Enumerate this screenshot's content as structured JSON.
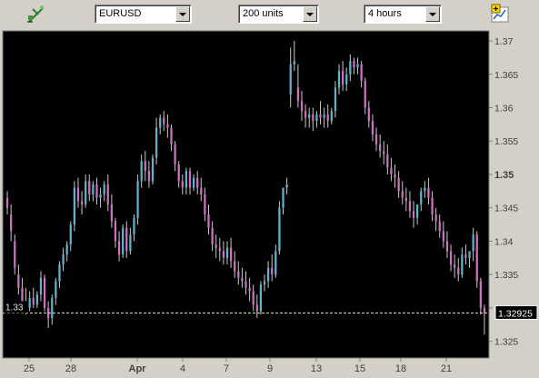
{
  "toolbar": {
    "left_icon": "chart-tool-icon",
    "right_icon": "add-chart-icon",
    "symbol": "EURUSD",
    "units": "200 units",
    "timeframe": "4 hours"
  },
  "colors": {
    "background": "#000000",
    "bullish": "#5fb4c8",
    "bearish": "#d070c0",
    "last_price_line": "#f0e6b0",
    "axis_panel": "#d4d0c8"
  },
  "chart_data": {
    "type": "candlestick",
    "title": "",
    "xlabel": "",
    "ylabel": "",
    "ylim": [
      1.3225,
      1.3715
    ],
    "y_ticks": [
      "1.37",
      "1.365",
      "1.36",
      "1.355",
      "1.35",
      "1.345",
      "1.34",
      "1.335",
      "1.33",
      "1.325"
    ],
    "x_ticks": [
      "25",
      "28",
      "Apr",
      "4",
      "7",
      "9",
      "13",
      "15",
      "18",
      "21"
    ],
    "left_price_label": "1.33",
    "last_price": "1.32925",
    "grid": false,
    "candles": [
      [
        1.3465,
        1.3475,
        1.345,
        1.344
      ],
      [
        1.344,
        1.3455,
        1.3415,
        1.34
      ],
      [
        1.34,
        1.341,
        1.336,
        1.335
      ],
      [
        1.335,
        1.3365,
        1.333,
        1.332
      ],
      [
        1.333,
        1.3345,
        1.331,
        1.3305
      ],
      [
        1.331,
        1.333,
        1.33,
        1.329
      ],
      [
        1.33,
        1.3325,
        1.3315,
        1.3295
      ],
      [
        1.3315,
        1.333,
        1.3305,
        1.33
      ],
      [
        1.3305,
        1.3325,
        1.332,
        1.33
      ],
      [
        1.332,
        1.3355,
        1.3345,
        1.331
      ],
      [
        1.3345,
        1.335,
        1.33,
        1.3295
      ],
      [
        1.33,
        1.331,
        1.3285,
        1.327
      ],
      [
        1.3285,
        1.332,
        1.3315,
        1.3275
      ],
      [
        1.3315,
        1.3345,
        1.334,
        1.3305
      ],
      [
        1.334,
        1.337,
        1.3365,
        1.333
      ],
      [
        1.3365,
        1.339,
        1.338,
        1.3355
      ],
      [
        1.338,
        1.34,
        1.3395,
        1.337
      ],
      [
        1.3395,
        1.343,
        1.3425,
        1.3385
      ],
      [
        1.3425,
        1.349,
        1.348,
        1.3415
      ],
      [
        1.348,
        1.3495,
        1.346,
        1.345
      ],
      [
        1.346,
        1.3475,
        1.3455,
        1.344
      ],
      [
        1.3455,
        1.35,
        1.349,
        1.345
      ],
      [
        1.349,
        1.35,
        1.347,
        1.346
      ],
      [
        1.347,
        1.349,
        1.3485,
        1.346
      ],
      [
        1.3485,
        1.3495,
        1.3465,
        1.3455
      ],
      [
        1.3465,
        1.348,
        1.347,
        1.345
      ],
      [
        1.347,
        1.349,
        1.3485,
        1.346
      ],
      [
        1.3485,
        1.35,
        1.3455,
        1.3445
      ],
      [
        1.3455,
        1.347,
        1.343,
        1.342
      ],
      [
        1.343,
        1.3435,
        1.34,
        1.339
      ],
      [
        1.34,
        1.3415,
        1.338,
        1.337
      ],
      [
        1.338,
        1.3425,
        1.342,
        1.3375
      ],
      [
        1.342,
        1.343,
        1.3385,
        1.3375
      ],
      [
        1.3385,
        1.342,
        1.341,
        1.338
      ],
      [
        1.341,
        1.344,
        1.3435,
        1.34
      ],
      [
        1.3435,
        1.35,
        1.349,
        1.3425
      ],
      [
        1.349,
        1.353,
        1.352,
        1.348
      ],
      [
        1.352,
        1.3535,
        1.3505,
        1.349
      ],
      [
        1.3505,
        1.352,
        1.349,
        1.348
      ],
      [
        1.349,
        1.353,
        1.3525,
        1.3485
      ],
      [
        1.3525,
        1.3585,
        1.357,
        1.3515
      ],
      [
        1.357,
        1.359,
        1.3585,
        1.356
      ],
      [
        1.3585,
        1.3595,
        1.3575,
        1.3565
      ],
      [
        1.3575,
        1.359,
        1.357,
        1.3555
      ],
      [
        1.357,
        1.3575,
        1.3545,
        1.3535
      ],
      [
        1.3545,
        1.355,
        1.3515,
        1.3505
      ],
      [
        1.3515,
        1.352,
        1.349,
        1.348
      ],
      [
        1.349,
        1.35,
        1.348,
        1.347
      ],
      [
        1.348,
        1.351,
        1.3505,
        1.347
      ],
      [
        1.3505,
        1.351,
        1.348,
        1.347
      ],
      [
        1.348,
        1.35,
        1.3495,
        1.3475
      ],
      [
        1.3495,
        1.3505,
        1.348,
        1.347
      ],
      [
        1.348,
        1.3495,
        1.347,
        1.346
      ],
      [
        1.347,
        1.348,
        1.344,
        1.343
      ],
      [
        1.344,
        1.3455,
        1.342,
        1.341
      ],
      [
        1.342,
        1.343,
        1.3395,
        1.3385
      ],
      [
        1.3395,
        1.341,
        1.339,
        1.3375
      ],
      [
        1.339,
        1.3405,
        1.3385,
        1.337
      ],
      [
        1.3385,
        1.34,
        1.3375,
        1.3365
      ],
      [
        1.3375,
        1.34,
        1.339,
        1.3365
      ],
      [
        1.339,
        1.3405,
        1.337,
        1.336
      ],
      [
        1.337,
        1.3385,
        1.3355,
        1.3345
      ],
      [
        1.3355,
        1.337,
        1.3345,
        1.3335
      ],
      [
        1.3345,
        1.336,
        1.334,
        1.333
      ],
      [
        1.334,
        1.3355,
        1.333,
        1.332
      ],
      [
        1.333,
        1.3345,
        1.3325,
        1.331
      ],
      [
        1.3325,
        1.3335,
        1.3305,
        1.3295
      ],
      [
        1.3305,
        1.332,
        1.3295,
        1.3285
      ],
      [
        1.3295,
        1.334,
        1.3335,
        1.329
      ],
      [
        1.3335,
        1.335,
        1.334,
        1.3325
      ],
      [
        1.334,
        1.337,
        1.336,
        1.333
      ],
      [
        1.336,
        1.338,
        1.335,
        1.334
      ],
      [
        1.335,
        1.3395,
        1.3385,
        1.3345
      ],
      [
        1.3385,
        1.346,
        1.345,
        1.338
      ],
      [
        1.345,
        1.3475,
        1.348,
        1.344
      ],
      [
        1.348,
        1.3495,
        1.3485,
        1.347
      ],
      [
        1.362,
        1.369,
        1.3665,
        1.36
      ],
      [
        1.3665,
        1.37,
        1.367,
        1.3655
      ],
      [
        1.363,
        1.3665,
        1.361,
        1.36
      ],
      [
        1.361,
        1.3625,
        1.3595,
        1.358
      ],
      [
        1.3595,
        1.3605,
        1.3585,
        1.357
      ],
      [
        1.3585,
        1.36,
        1.359,
        1.357
      ],
      [
        1.359,
        1.36,
        1.358,
        1.3565
      ],
      [
        1.358,
        1.3595,
        1.359,
        1.357
      ],
      [
        1.359,
        1.361,
        1.3585,
        1.3575
      ],
      [
        1.3585,
        1.36,
        1.359,
        1.357
      ],
      [
        1.359,
        1.3605,
        1.358,
        1.357
      ],
      [
        1.358,
        1.36,
        1.3595,
        1.3575
      ],
      [
        1.3595,
        1.364,
        1.363,
        1.3585
      ],
      [
        1.363,
        1.3665,
        1.3655,
        1.362
      ],
      [
        1.3655,
        1.367,
        1.3635,
        1.3625
      ],
      [
        1.3635,
        1.366,
        1.365,
        1.3625
      ],
      [
        1.365,
        1.368,
        1.367,
        1.364
      ],
      [
        1.367,
        1.3675,
        1.366,
        1.365
      ],
      [
        1.366,
        1.3675,
        1.3665,
        1.365
      ],
      [
        1.3665,
        1.367,
        1.364,
        1.363
      ],
      [
        1.364,
        1.3645,
        1.36,
        1.359
      ],
      [
        1.36,
        1.361,
        1.358,
        1.357
      ],
      [
        1.358,
        1.359,
        1.356,
        1.355
      ],
      [
        1.356,
        1.357,
        1.3545,
        1.3535
      ],
      [
        1.3545,
        1.356,
        1.3535,
        1.3525
      ],
      [
        1.3535,
        1.355,
        1.353,
        1.3515
      ],
      [
        1.353,
        1.3545,
        1.351,
        1.35
      ],
      [
        1.351,
        1.3525,
        1.35,
        1.349
      ],
      [
        1.35,
        1.3515,
        1.3495,
        1.348
      ],
      [
        1.3495,
        1.3505,
        1.3475,
        1.3465
      ],
      [
        1.3475,
        1.349,
        1.3465,
        1.3455
      ],
      [
        1.3465,
        1.348,
        1.346,
        1.3445
      ],
      [
        1.346,
        1.3475,
        1.3445,
        1.3435
      ],
      [
        1.3445,
        1.346,
        1.3435,
        1.342
      ],
      [
        1.3435,
        1.345,
        1.3455,
        1.3425
      ],
      [
        1.3455,
        1.348,
        1.3475,
        1.3445
      ],
      [
        1.3475,
        1.349,
        1.348,
        1.3465
      ],
      [
        1.348,
        1.3495,
        1.3465,
        1.3455
      ],
      [
        1.3465,
        1.3475,
        1.344,
        1.343
      ],
      [
        1.344,
        1.345,
        1.343,
        1.3415
      ],
      [
        1.343,
        1.344,
        1.3415,
        1.3405
      ],
      [
        1.3415,
        1.343,
        1.34,
        1.339
      ],
      [
        1.34,
        1.3415,
        1.3385,
        1.3375
      ],
      [
        1.3385,
        1.3395,
        1.3365,
        1.3355
      ],
      [
        1.3365,
        1.338,
        1.336,
        1.3345
      ],
      [
        1.336,
        1.3375,
        1.335,
        1.334
      ],
      [
        1.335,
        1.339,
        1.338,
        1.3345
      ],
      [
        1.338,
        1.3395,
        1.3375,
        1.3365
      ],
      [
        1.3375,
        1.3385,
        1.3385,
        1.336
      ],
      [
        1.3385,
        1.342,
        1.341,
        1.337
      ],
      [
        1.341,
        1.3415,
        1.334,
        1.333
      ],
      [
        1.334,
        1.3345,
        1.33,
        1.329
      ],
      [
        1.33,
        1.3305,
        1.3292,
        1.326
      ]
    ]
  }
}
